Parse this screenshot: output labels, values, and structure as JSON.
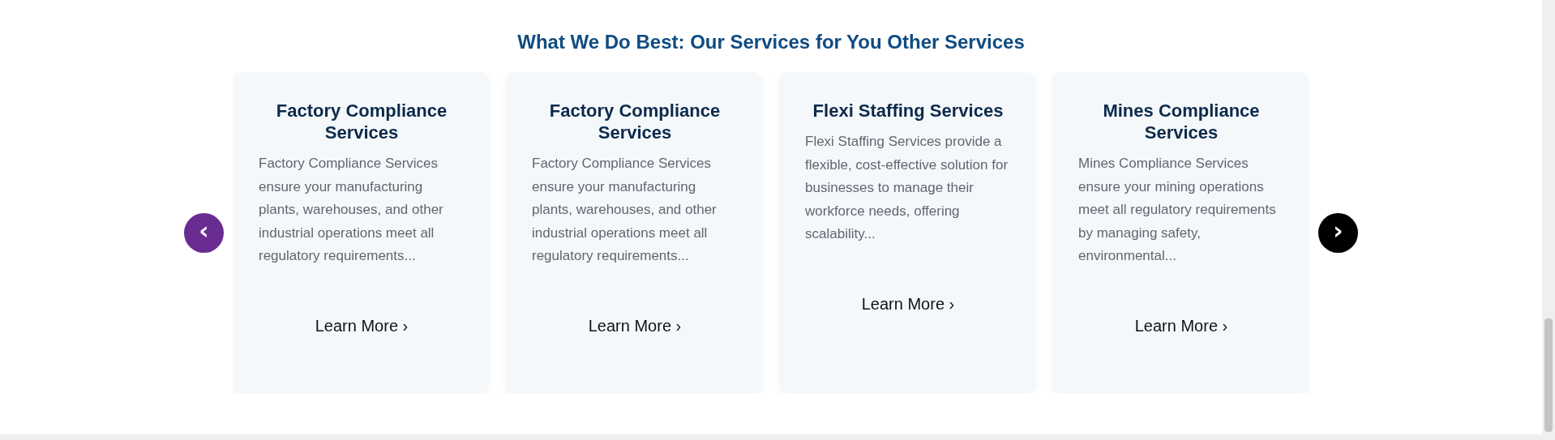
{
  "section": {
    "title": "What We Do Best: Our Services for You Other Services"
  },
  "carousel": {
    "prev": {
      "glyph": "‹",
      "highlighted": true
    },
    "next": {
      "glyph": "›",
      "highlighted": false
    },
    "cards": [
      {
        "title": "Factory Compliance Services",
        "description": "Factory Compliance Services ensure your manufacturing plants, warehouses, and other industrial operations meet all regulatory requirements...",
        "link": "Learn More ›"
      },
      {
        "title": "Factory Compliance Services",
        "description": "Factory Compliance Services ensure your manufacturing plants, warehouses, and other industrial operations meet all regulatory requirements...",
        "link": "Learn More ›"
      },
      {
        "title": "Flexi Staffing Services",
        "description": "Flexi Staffing Services provide a flexible, cost-effective solution for businesses to manage their workforce needs, offering scalability...",
        "link": "Learn More ›"
      },
      {
        "title": "Mines Compliance Services",
        "description": "Mines Compliance Services ensure your mining operations meet all regulatory requirements by managing safety, environmental...",
        "link": "Learn More ›"
      }
    ]
  }
}
